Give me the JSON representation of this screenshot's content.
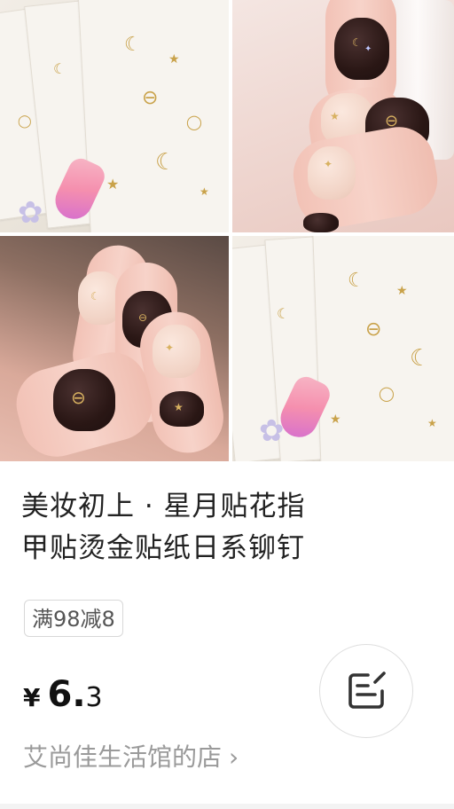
{
  "product": {
    "title_line1": "美妆初上 · 星月贴花指",
    "title_line2": "甲贴烫金贴纸日系铆钉",
    "promo_badge": "满98减8",
    "price_currency": "¥",
    "price_integer": "6.",
    "price_decimal": "3",
    "shop_name": "艾尚佳生活馆的店",
    "shop_chevron": "›"
  },
  "images": {
    "tiles": [
      "sticker-sheets",
      "hand-nails-closeup",
      "hand-nails-side",
      "sticker-sheets-alt"
    ]
  },
  "icons": {
    "edit": "edit-note-icon",
    "chevron": "chevron-right-icon"
  },
  "colors": {
    "title_text": "#222222",
    "muted_text": "#9a9a9a",
    "badge_border": "#d8d8d8",
    "price_text": "#111111",
    "gold_accent": "#c9a24a"
  }
}
